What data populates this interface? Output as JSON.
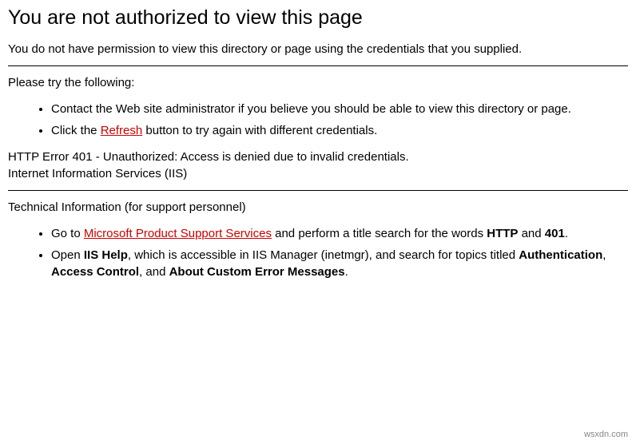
{
  "heading": "You are not authorized to view this page",
  "intro": "You do not have permission to view this directory or page using the credentials that you supplied.",
  "try_label": "Please try the following:",
  "try_items": {
    "contact": "Contact the Web site administrator if you believe you should be able to view this directory or page.",
    "click_prefix": "Click the ",
    "refresh_link": "Refresh",
    "click_suffix": " button to try again with different credentials."
  },
  "error_line": "HTTP Error 401 - Unauthorized: Access is denied due to invalid credentials.",
  "server_line": "Internet Information Services (IIS)",
  "tech_label": "Technical Information (for support personnel)",
  "tech_items": {
    "goto_prefix": "Go to ",
    "mpss_link": "Microsoft Product Support Services",
    "goto_mid": " and perform a title search for the words ",
    "http_bold": "HTTP",
    "and1": " and ",
    "code_bold": "401",
    "goto_suffix": ".",
    "open_prefix": "Open ",
    "iis_help_bold": "IIS Help",
    "open_mid": ", which is accessible in IIS Manager (inetmgr), and search for topics titled ",
    "auth_bold": "Authentication",
    "comma1": ", ",
    "access_bold": "Access Control",
    "comma_and": ", and ",
    "about_bold": "About Custom Error Messages",
    "open_suffix": "."
  },
  "watermark": "wsxdn.com"
}
